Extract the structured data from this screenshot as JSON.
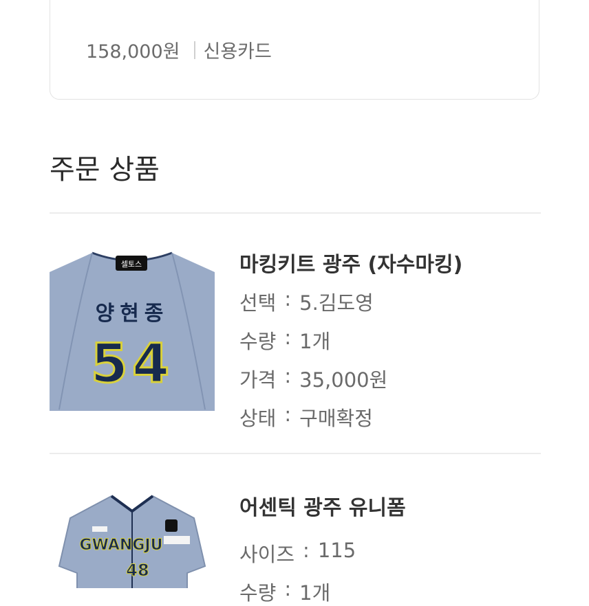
{
  "payment": {
    "amount": "158,000원",
    "method": "신용카드"
  },
  "section_title": "주문 상품",
  "items": [
    {
      "name": "마킹키트 광주 (자수마킹)",
      "image": {
        "tag": "셀토스",
        "player_name": "양현종",
        "number": "54"
      },
      "options": [
        {
          "label": "선택",
          "value": "5.김도영"
        },
        {
          "label": "수량",
          "value": "1개"
        },
        {
          "label": "가격",
          "value": "35,000원"
        },
        {
          "label": "상태",
          "value": "구매확정"
        }
      ]
    },
    {
      "name": "어센틱 광주 유니폼",
      "image": {
        "wordmark": "GWANGJU",
        "number": "48"
      },
      "options": [
        {
          "label": "사이즈",
          "value": "115"
        },
        {
          "label": "수량",
          "value": "1개"
        }
      ]
    }
  ],
  "colors": {
    "jersey": "#9aabc7",
    "navy": "#172a4e",
    "yellow": "#d9d13a"
  }
}
